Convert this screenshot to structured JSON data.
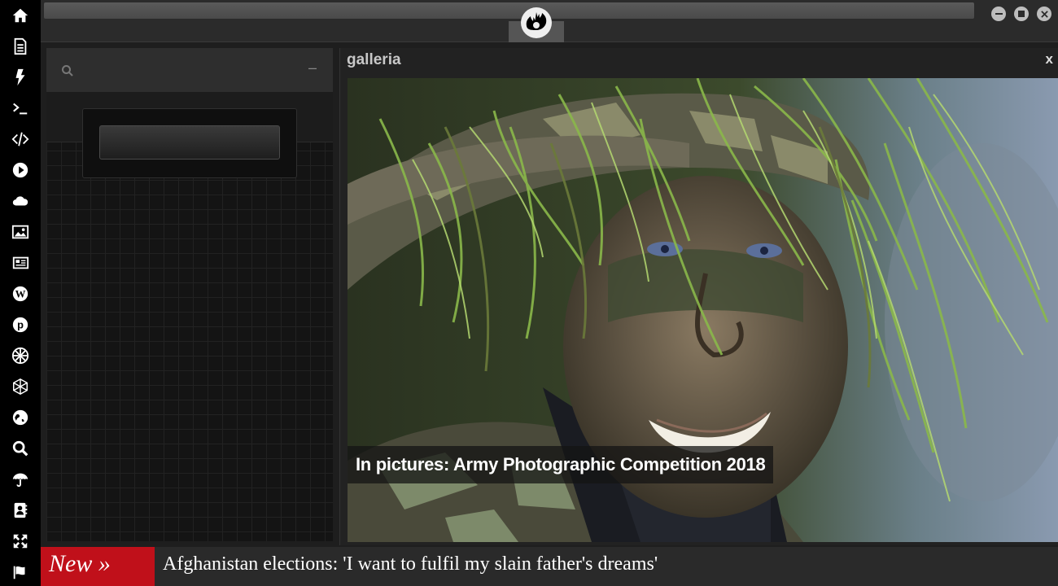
{
  "dock": {
    "items": [
      {
        "icon": "home-icon"
      },
      {
        "icon": "document-icon"
      },
      {
        "icon": "lightning-icon"
      },
      {
        "icon": "terminal-icon"
      },
      {
        "icon": "code-icon"
      },
      {
        "icon": "play-icon"
      },
      {
        "icon": "cloud-icon"
      },
      {
        "icon": "image-icon"
      },
      {
        "icon": "newspaper-icon"
      },
      {
        "icon": "wordpress-icon"
      },
      {
        "icon": "pinterest-icon"
      },
      {
        "icon": "empire-icon"
      },
      {
        "icon": "polyhedron-icon"
      },
      {
        "icon": "globe-icon"
      },
      {
        "icon": "search-icon"
      },
      {
        "icon": "umbrella-icon"
      },
      {
        "icon": "contact-book-icon"
      },
      {
        "icon": "expand-icon"
      },
      {
        "icon": "flag-icon"
      }
    ]
  },
  "topbar": {
    "logo_icon": "rebel-alliance-icon"
  },
  "gallery": {
    "title": "galleria",
    "close_label": "x",
    "caption": "In pictures: Army Photographic Competition 2018"
  },
  "left_panel": {
    "minimize_label": "–"
  },
  "ticker": {
    "badge": "New »",
    "headline": "Afghanistan elections: 'I want to fulfil my slain father's dreams'",
    "badge_color": "#c0101a"
  }
}
